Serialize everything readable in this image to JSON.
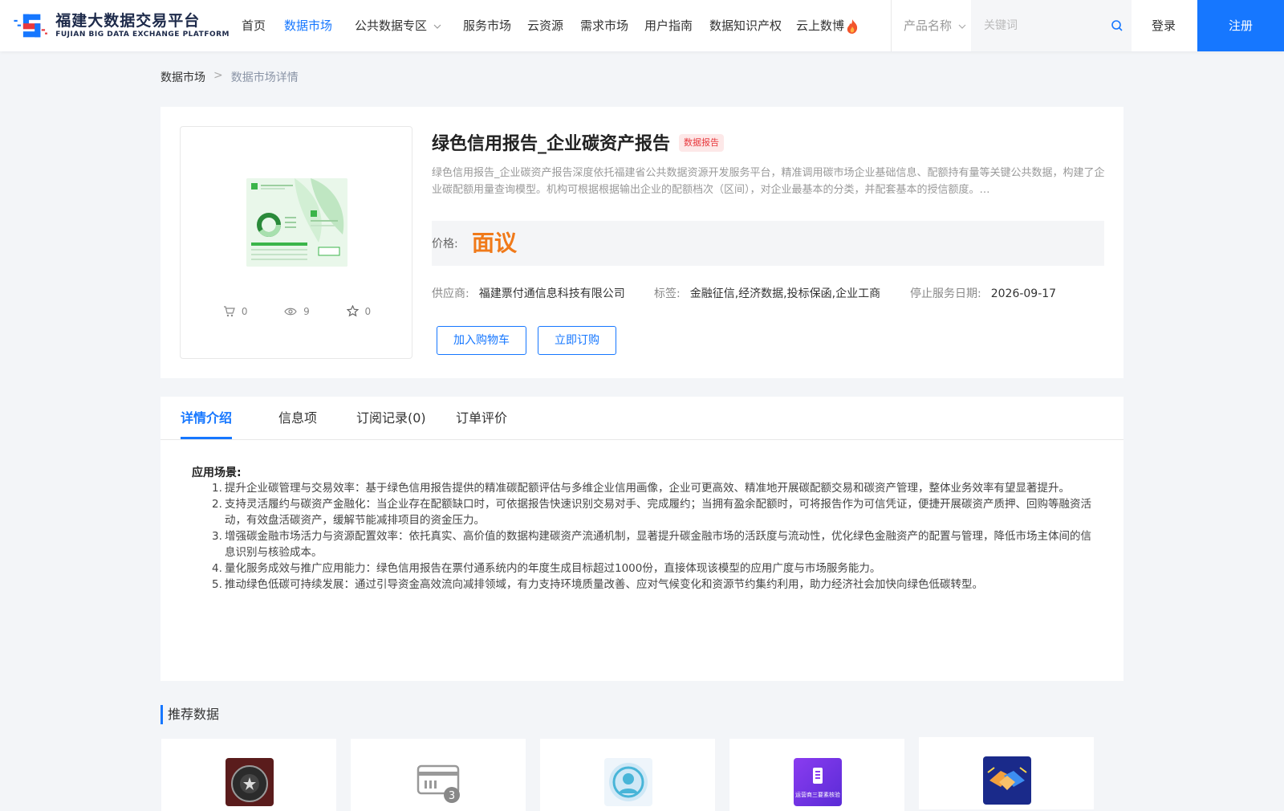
{
  "header": {
    "logo_cn": "福建大数据交易平台",
    "logo_en": "FUJIAN BIG DATA EXCHANGE  PLATFORM",
    "nav": [
      {
        "label": "首页"
      },
      {
        "label": "数据市场",
        "active": true
      },
      {
        "label": "公共数据专区"
      },
      {
        "label": "服务市场"
      },
      {
        "label": "云资源"
      },
      {
        "label": "需求市场"
      },
      {
        "label": "用户指南"
      },
      {
        "label": "数据知识产权"
      },
      {
        "label": "云上数博"
      }
    ],
    "search_type": "产品名称",
    "search_placeholder": "关键词",
    "login": "登录",
    "register": "注册",
    "accent_color": "#1677ff"
  },
  "breadcrumb": {
    "home": "数据市场",
    "separator": ">",
    "current": "数据市场详情"
  },
  "product": {
    "title": "绿色信用报告_企业碳资产报告",
    "category_badge": "数据报告",
    "description": "绿色信用报告_企业碳资产报告深度依托福建省公共数据资源开发服务平台，精准调用碳市场企业基础信息、配额持有量等关键公共数据，构建了企业碳配额用量查询模型。机构可根据根据输出企业的配额档次（区间），对企业最基本的分类，并配套基本的授信额度。…",
    "stats": {
      "cart": "0",
      "views": "9",
      "favorites": "0"
    },
    "price_label": "价格:",
    "price": "面议",
    "supplier_label": "供应商:",
    "supplier": "福建票付通信息科技有限公司",
    "tags_label": "标签:",
    "tags": "金融征信,经济数据,投标保函,企业工商",
    "stop_date_label": "停止服务日期:",
    "stop_date": "2026-09-17",
    "add_cart_button": "加入购物车",
    "subscribe_button": "立即订购"
  },
  "tabs": [
    {
      "label": "详情介绍",
      "active": true
    },
    {
      "label": "信息项"
    },
    {
      "label": "订阅记录(0)"
    },
    {
      "label": "订单评价"
    }
  ],
  "detail": {
    "scene_title": "应用场景:",
    "items": [
      "提升企业碳管理与交易效率：基于绿色信用报告提供的精准碳配额评估与多维企业信用画像，企业可更高效、精准地开展碳配额交易和碳资产管理，整体业务效率有望显著提升。",
      "支持灵活履约与碳资产金融化：当企业存在配额缺口时，可依据报告快速识别交易对手、完成履约；当拥有盈余配额时，可将报告作为可信凭证，便捷开展碳资产质押、回购等融资活动，有效盘活碳资产，缓解节能减排项目的资金压力。",
      "增强碳金融市场活力与资源配置效率：依托真实、高价值的数据构建碳资产流通机制，显著提升碳金融市场的活跃度与流动性，优化绿色金融资产的配置与管理，降低市场主体间的信息识别与核验成本。",
      "量化服务成效与推广应用能力：绿色信用报告在票付通系统内的年度生成目标超过1000份，直接体现该模型的应用广度与市场服务能力。",
      "推动绿色低碳可持续发展：通过引导资金高效流向减排领域，有力支持环境质量改善、应对气候变化和资源节约集约利用，助力经济社会加快向绿色低碳转型。"
    ]
  },
  "recommend": {
    "title": "推荐数据",
    "cards": [
      {
        "icon": "shield-badge-icon"
      },
      {
        "icon": "card-reader-icon"
      },
      {
        "icon": "face-scan-icon"
      },
      {
        "icon": "phone-elements-icon",
        "caption": "运营商三要素核验"
      },
      {
        "icon": "handshake-icon"
      }
    ]
  }
}
